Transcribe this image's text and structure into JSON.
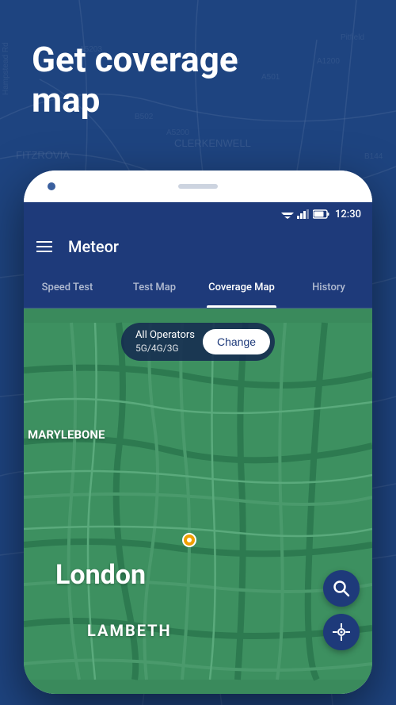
{
  "background": {
    "color": "#1e4480"
  },
  "title": {
    "line1": "Get coverage",
    "line2": "map"
  },
  "phone": {
    "status_bar": {
      "time": "12:30"
    },
    "header": {
      "app_name": "Meteor",
      "menu_icon": "hamburger-icon"
    },
    "tabs": [
      {
        "label": "Speed Test",
        "active": false
      },
      {
        "label": "Test Map",
        "active": false
      },
      {
        "label": "Coverage Map",
        "active": true
      },
      {
        "label": "History",
        "active": false
      }
    ],
    "map": {
      "filter": {
        "operator": "All Operators",
        "network": "5G/4G/3G",
        "change_button": "Change"
      },
      "labels": {
        "marylebone": "MARYLEBONE",
        "london": "London",
        "lambeth": "LAMBETH"
      }
    }
  }
}
